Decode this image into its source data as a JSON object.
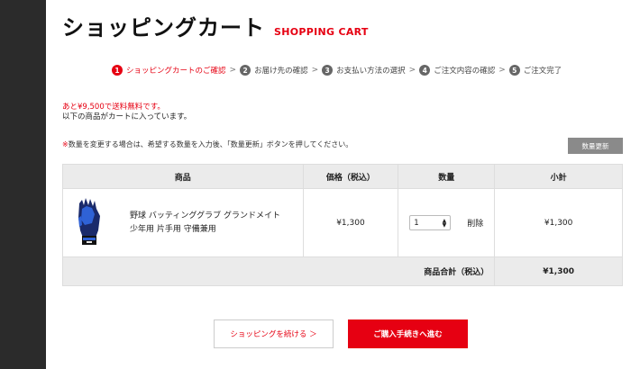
{
  "header": {
    "title_jp": "ショッピングカート",
    "title_en": "SHOPPING CART"
  },
  "steps": [
    {
      "num": "1",
      "label": "ショッピングカートのご確認",
      "active": true
    },
    {
      "num": "2",
      "label": "お届け先の確認",
      "active": false
    },
    {
      "num": "3",
      "label": "お支払い方法の選択",
      "active": false
    },
    {
      "num": "4",
      "label": "ご注文内容の確認",
      "active": false
    },
    {
      "num": "5",
      "label": "ご注文完了",
      "active": false
    }
  ],
  "step_arrow": ">",
  "notice": {
    "free_shipping": "あと¥9,500で送料無料です。",
    "items_in_cart": "以下の商品がカートに入っています。"
  },
  "qty_note": {
    "mark": "※",
    "text": "数量を変更する場合は、希望する数量を入力後、「数量更新」ボタンを押してください。"
  },
  "update_button_label": "数量更新",
  "table": {
    "headers": {
      "product": "商品",
      "price": "価格（税込）",
      "qty": "数量",
      "subtotal": "小計"
    },
    "items": [
      {
        "name_line1": "野球 バッティンググラブ グランドメイト",
        "name_line2": "少年用 片手用 守備兼用",
        "price": "¥1,300",
        "qty": "1",
        "delete_label": "削除",
        "subtotal": "¥1,300"
      }
    ],
    "total_label": "商品合計（税込）",
    "total_value": "¥1,300"
  },
  "buttons": {
    "continue": "ショッピングを続ける ＞",
    "checkout": "ご購入手続きへ進む"
  },
  "colors": {
    "accent": "#e60012",
    "sidebar": "#2b2b2b",
    "table_header_bg": "#ebebeb"
  }
}
